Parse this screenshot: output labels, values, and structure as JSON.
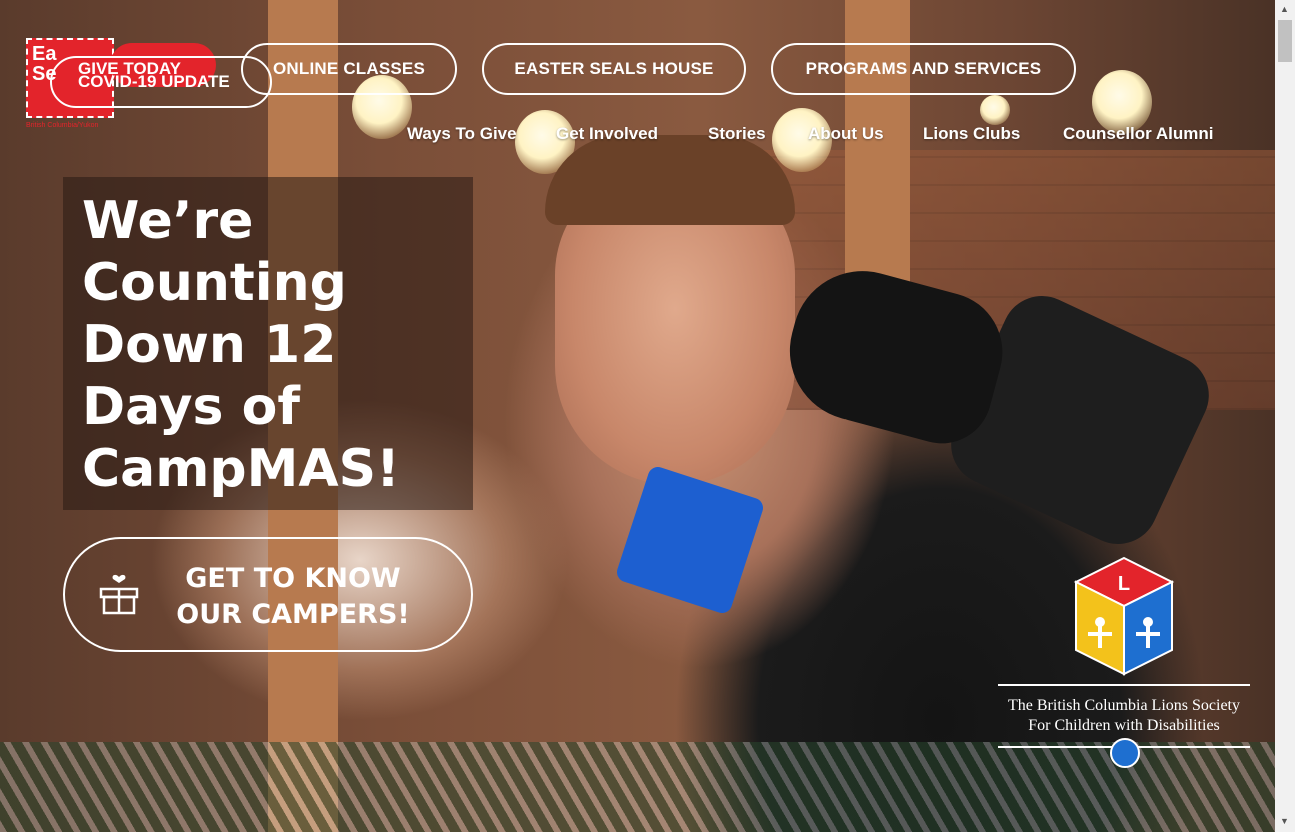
{
  "logo": {
    "text": "Easter Seals",
    "text_line1": "Ea",
    "text_line2": "Se",
    "subtitle": "British Columbia/Yukon",
    "brand_color": "#e3242b"
  },
  "top_buttons": {
    "give_today": "GIVE TODAY",
    "covid_update": "COVID-19 UPDATE",
    "online_classes": "ONLINE CLASSES",
    "easter_seals_house": "EASTER SEALS HOUSE",
    "programs_services": "PROGRAMS AND SERVICES"
  },
  "nav": {
    "items": [
      "Ways To Give",
      "Get Involved",
      "Stories",
      "About Us",
      "Lions Clubs",
      "Counsellor Alumni"
    ]
  },
  "hero": {
    "headline": "We’re Counting Down 12 Days of CampMAS!",
    "cta_line1": "GET TO KNOW",
    "cta_line2": "OUR CAMPERS!",
    "cta_icon": "gift-box-icon"
  },
  "lions": {
    "line1": "The British Columbia Lions Society",
    "line2": "For Children with Disabilities",
    "icon": "lions-block-icon"
  }
}
